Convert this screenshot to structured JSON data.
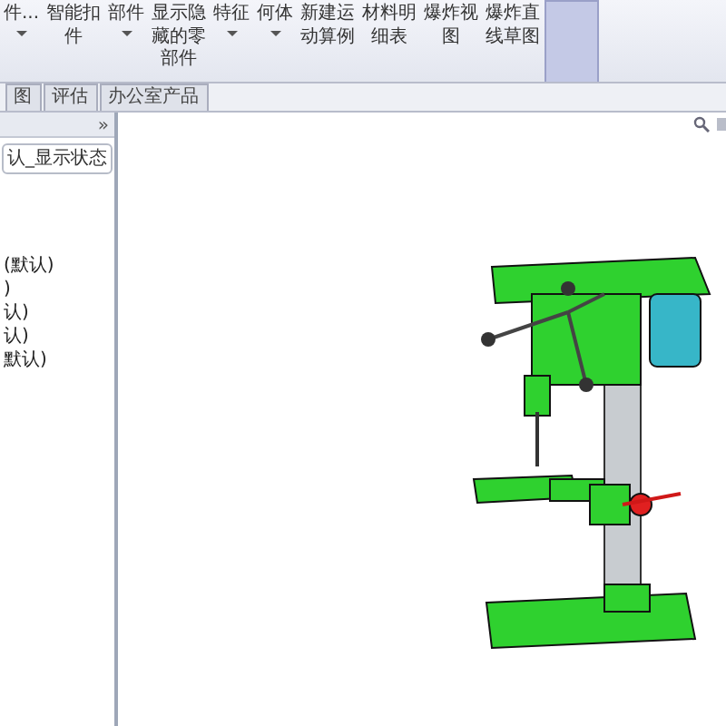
{
  "ribbon": [
    {
      "lines": [
        "件..."
      ],
      "dropdown": true,
      "selected": false
    },
    {
      "lines": [
        "智能扣",
        "件"
      ],
      "dropdown": false,
      "selected": false
    },
    {
      "lines": [
        "部件"
      ],
      "dropdown": true,
      "selected": false
    },
    {
      "lines": [
        "显示隐",
        "藏的零",
        "部件"
      ],
      "dropdown": false,
      "selected": false
    },
    {
      "lines": [
        "特征"
      ],
      "dropdown": true,
      "selected": false
    },
    {
      "lines": [
        "何体"
      ],
      "dropdown": true,
      "selected": false
    },
    {
      "lines": [
        "新建运",
        "动算例"
      ],
      "dropdown": false,
      "selected": false
    },
    {
      "lines": [
        "材料明",
        "细表"
      ],
      "dropdown": false,
      "selected": false
    },
    {
      "lines": [
        "爆炸视",
        "图"
      ],
      "dropdown": false,
      "selected": false
    },
    {
      "lines": [
        "爆炸直",
        "线草图"
      ],
      "dropdown": false,
      "selected": false
    },
    {
      "dropdown": false,
      "selected": true
    }
  ],
  "tabs": [
    {
      "label": "图",
      "selected": false
    },
    {
      "label": "评估",
      "selected": false
    },
    {
      "label": "办公室产品",
      "selected": false
    }
  ],
  "sidebar": {
    "collapse": "»",
    "config": "认_显示状态",
    "items": [
      "(默认)",
      ")",
      "认)",
      "认)",
      "默认)"
    ]
  }
}
